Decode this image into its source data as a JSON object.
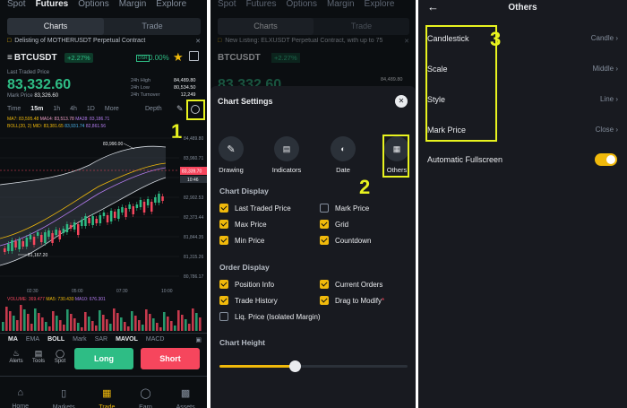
{
  "nav_tabs": [
    "Spot",
    "Futures",
    "Options",
    "Margin",
    "Explore"
  ],
  "nav_tabs_p2": [
    "Spot",
    "Futures",
    "Options",
    "Margin",
    "Explore"
  ],
  "segment": {
    "charts": "Charts",
    "trade": "Trade"
  },
  "notice1": "Delisting of MOTHERUSDT Perpetual Contract",
  "notice2": "New Listing: ELXUSDT Perpetual Contract, with up to 75",
  "ticker": {
    "symbol": "BTCUSDT",
    "change": "+2.27%",
    "change2": "0.00%",
    "last_label": "Last Traded Price",
    "price": "83,332.60",
    "mark_label": "Mark Price",
    "mark_value": "83,326.60",
    "high_label": "24h High",
    "high": "84,489.80",
    "low_label": "24h Low",
    "low": "80,534.50",
    "turn_label": "24h Turnover",
    "turn": "12,249"
  },
  "timebar": [
    "Time",
    "15m",
    "1h",
    "4h",
    "1D",
    "More"
  ],
  "depth": "Depth",
  "ma_line": {
    "ma7": "MA7: 83,595.48",
    "ma14": "MA14: 83,513.78",
    "ma28": "MA28: 83,186.71"
  },
  "boll_line": {
    "boll": "BOLL(20, 2) MID: 83,381.65",
    "up": "83,931.74",
    "dn": "82,861.56"
  },
  "chart": {
    "high_label": "83,990.00",
    "low_label": "81,167.20",
    "price_tag": "83,339.70",
    "timer": "10:46",
    "y_ticks": [
      "84,489.80",
      "83,960.71",
      "83,431.62",
      "82,902.53",
      "82,373.44",
      "81,844.35",
      "81,315.26",
      "80,786.17"
    ],
    "x_ticks": [
      "02:30",
      "05:00",
      "07:30",
      "10:00"
    ]
  },
  "volume_line": {
    "vol": "VOLUME: 369.477",
    "ma5": "MA5: 730.430",
    "ma10": "MA10: 676.301"
  },
  "indicators": [
    "MA",
    "EMA",
    "BOLL",
    "Mark",
    "SAR",
    "MAVOL",
    "MACD"
  ],
  "actions": {
    "alerts": "Alerts",
    "tools": "Tools",
    "spot": "Spot",
    "long": "Long",
    "short": "Short"
  },
  "bottom_nav": [
    "Home",
    "Markets",
    "Trade",
    "Earn",
    "Assets"
  ],
  "callouts": {
    "one": "1",
    "two": "2",
    "three": "3"
  },
  "settings": {
    "title": "Chart Settings",
    "tools": [
      "Drawing",
      "Indicators",
      "Date",
      "Others"
    ],
    "display_title": "Chart Display",
    "display": [
      {
        "label": "Last Traded Price",
        "on": true
      },
      {
        "label": "Mark Price",
        "on": false
      },
      {
        "label": "Max Price",
        "on": true
      },
      {
        "label": "Grid",
        "on": true
      },
      {
        "label": "Min Price",
        "on": true
      },
      {
        "label": "Countdown",
        "on": true
      }
    ],
    "order_title": "Order Display",
    "orders": [
      {
        "label": "Position Info",
        "on": true
      },
      {
        "label": "Current Orders",
        "on": true
      },
      {
        "label": "Trade History",
        "on": true
      },
      {
        "label": "Drag to Modify",
        "on": true
      },
      {
        "label": "Liq. Price (Isolated Margin)",
        "on": false
      }
    ],
    "height_title": "Chart Height",
    "height_fraction": 0.4
  },
  "others": {
    "title": "Others",
    "rows": [
      {
        "label": "Candlestick",
        "value": "Candle"
      },
      {
        "label": "Scale",
        "value": "Middle"
      },
      {
        "label": "Style",
        "value": "Line"
      },
      {
        "label": "Mark Price",
        "value": "Close"
      }
    ],
    "fullscreen": "Automatic Fullscreen",
    "fullscreen_on": true
  }
}
